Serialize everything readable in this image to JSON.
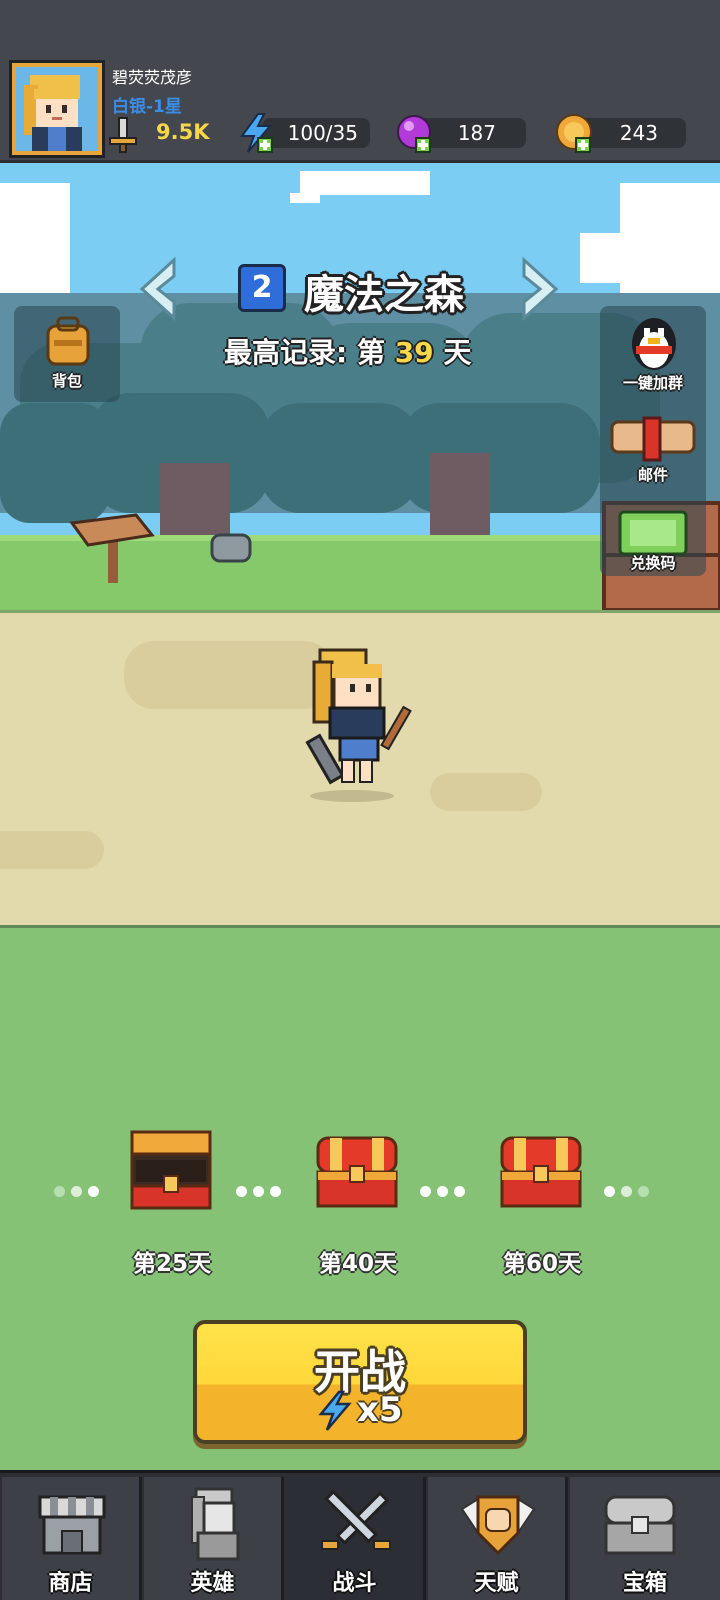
{
  "header": {
    "player_name": "碧荧荧茂彦",
    "rank": "白银-1星",
    "power": "9.5K",
    "energy": "100/35",
    "gems": "187",
    "coins": "243"
  },
  "stage": {
    "number": "2",
    "name": "魔法之森",
    "record_prefix": "最高记录: 第",
    "record_day": "39",
    "record_suffix": "天"
  },
  "side_buttons": {
    "backpack": "背包",
    "join_group": "一键加群",
    "mail": "邮件",
    "redeem": "兑换码"
  },
  "chests": [
    {
      "label": "第25天",
      "state": "opened"
    },
    {
      "label": "第40天",
      "state": "closed"
    },
    {
      "label": "第60天",
      "state": "closed"
    }
  ],
  "start_button": {
    "label": "开战",
    "cost": "x5"
  },
  "nav": [
    {
      "label": "商店",
      "icon": "shop-icon"
    },
    {
      "label": "英雄",
      "icon": "hero-icon"
    },
    {
      "label": "战斗",
      "icon": "crossed-swords-icon",
      "active": true
    },
    {
      "label": "天赋",
      "icon": "talent-fist-icon"
    },
    {
      "label": "宝箱",
      "icon": "treasure-chest-icon"
    }
  ],
  "colors": {
    "sky": "#7ccdf3",
    "grass": "#86c275",
    "road": "#e2d9ac",
    "button_yellow": "#ffd83a",
    "record_highlight": "#f7d84a",
    "rank_blue": "#3a8de8"
  }
}
